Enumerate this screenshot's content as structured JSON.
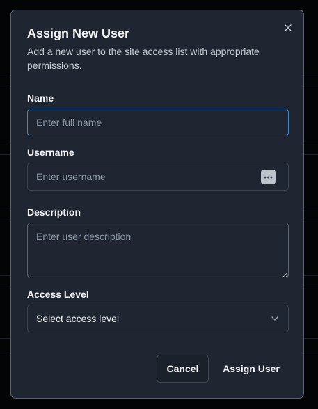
{
  "dialog": {
    "title": "Assign New User",
    "subtitle": "Add a new user to the site access list with appropriate permissions.",
    "close_icon": "close-icon"
  },
  "form": {
    "name": {
      "label": "Name",
      "placeholder": "Enter full name",
      "value": ""
    },
    "username": {
      "label": "Username",
      "placeholder": "Enter username",
      "value": "",
      "trailing_icon": "password-manager-icon"
    },
    "description": {
      "label": "Description",
      "placeholder": "Enter user description",
      "value": ""
    },
    "access_level": {
      "label": "Access Level",
      "selected": "Select access level",
      "icon": "chevron-down-icon"
    }
  },
  "actions": {
    "cancel_label": "Cancel",
    "assign_label": "Assign User"
  },
  "colors": {
    "dialog_bg": "#1f2632",
    "focus_border": "#3d86d6",
    "text_primary": "#f3f5f8",
    "text_muted": "#8b95a3"
  }
}
